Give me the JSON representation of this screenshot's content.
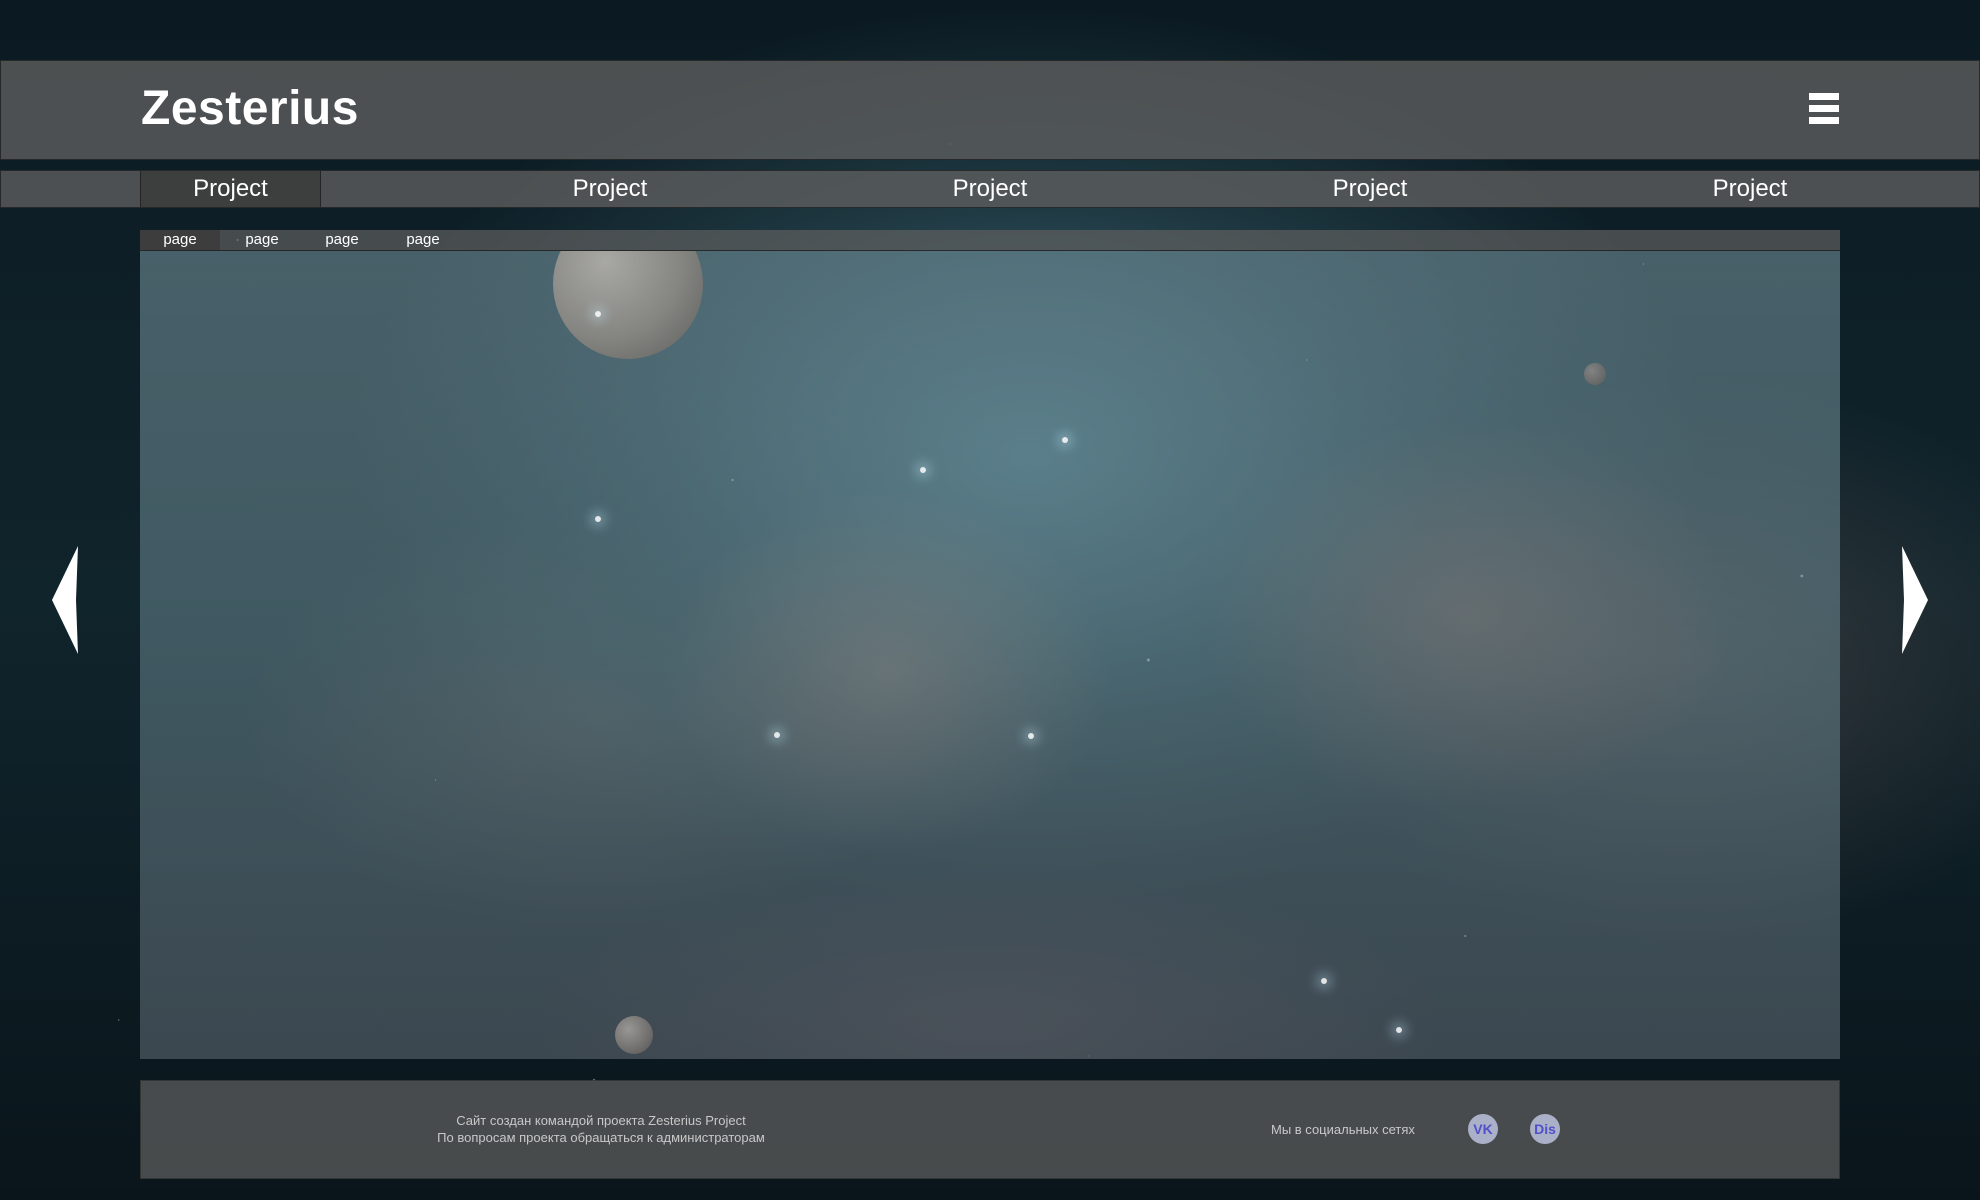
{
  "header": {
    "logo": "Zesterius",
    "menu_icon": "hamburger-menu-icon"
  },
  "project_nav": {
    "tabs": [
      {
        "label": "Project",
        "active": true
      },
      {
        "label": "Project",
        "active": false
      },
      {
        "label": "Project",
        "active": false
      },
      {
        "label": "Project",
        "active": false
      },
      {
        "label": "Project",
        "active": false
      }
    ]
  },
  "page_nav": {
    "tabs": [
      {
        "label": "page",
        "active": true
      },
      {
        "label": "page",
        "active": false
      },
      {
        "label": "page",
        "active": false
      },
      {
        "label": "page",
        "active": false
      }
    ]
  },
  "slider": {
    "prev_icon": "arrow-left-icon",
    "next_icon": "arrow-right-icon"
  },
  "footer": {
    "credit_line_1": "Сайт создан командой проекта Zesterius Project",
    "credit_line_2": "По вопросам проекта обращаться к администраторам",
    "social_label": "Мы в социальных сетях",
    "social": [
      {
        "label": "VK"
      },
      {
        "label": "Dis"
      }
    ]
  },
  "colors": {
    "panel": "#5f5f5f",
    "active_tab": "#3c3c3c",
    "badge_bg": "#aab0c8",
    "badge_text": "#5150c8",
    "text": "#ffffff",
    "footer_text": "#c8c8c8"
  }
}
